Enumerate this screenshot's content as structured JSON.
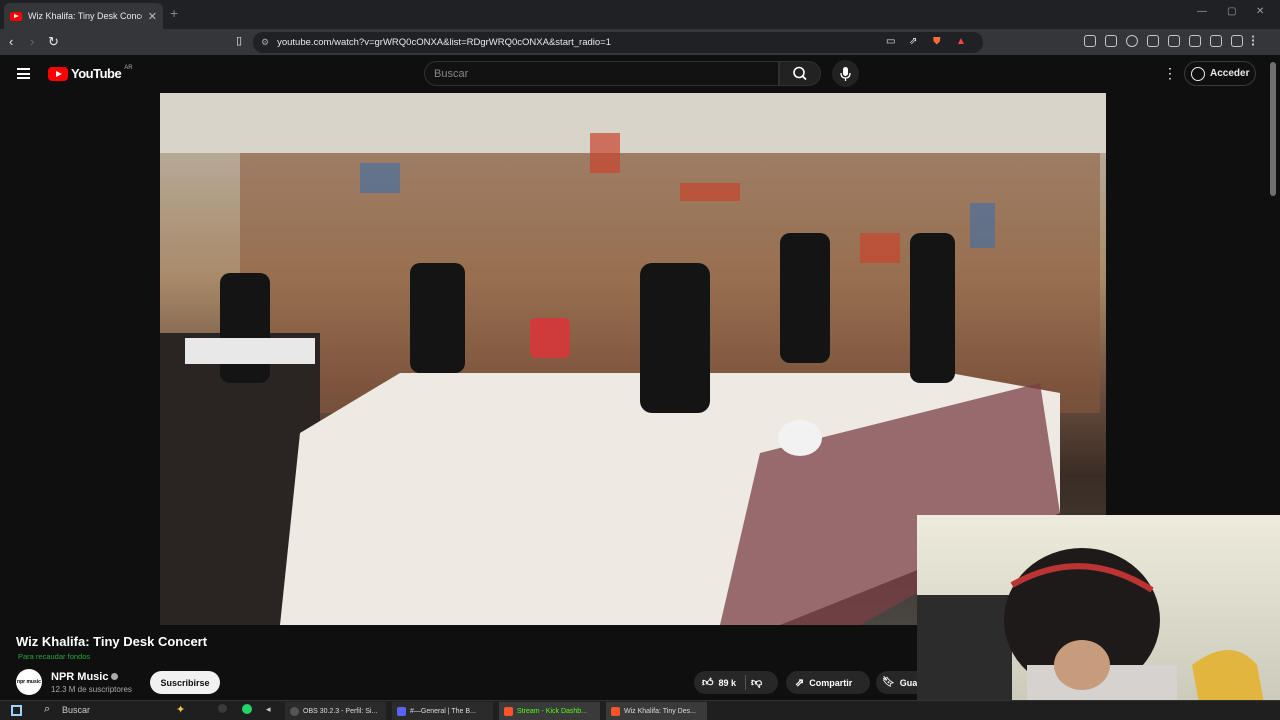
{
  "browser": {
    "tab_title": "Wiz Khalifa: Tiny Desk Concert",
    "new_tab": "+",
    "url": "youtube.com/watch?v=grWRQ0cONXA&list=RDgrWRQ0cONXA&start_radio=1"
  },
  "youtube": {
    "logo_text": "YouTube",
    "country_code": "AR",
    "search_placeholder": "Buscar",
    "sign_in": "Acceder"
  },
  "video": {
    "title": "Wiz Khalifa: Tiny Desk Concert",
    "subtitle": "Para recaudar fondos",
    "channel": {
      "name": "NPR Music",
      "avatar_text": "npr music",
      "subscribers": "12.3 M de suscriptores"
    },
    "subscribe_label": "Suscribirse",
    "likes": "89 k",
    "share_label": "Compartir",
    "save_label": "Gua"
  },
  "taskbar": {
    "search": "Buscar",
    "items": [
      {
        "label": "OBS 30.2.3 - Perfil: Si..."
      },
      {
        "label": "#—General | The B..."
      },
      {
        "label": "Stream - Kick Dashb..."
      },
      {
        "label": "Wiz Khalifa: Tiny Des..."
      }
    ]
  },
  "colors": {
    "accent": "#ff0000",
    "background": "#0f0f0f",
    "fundraiser_green": "#2ba640"
  }
}
